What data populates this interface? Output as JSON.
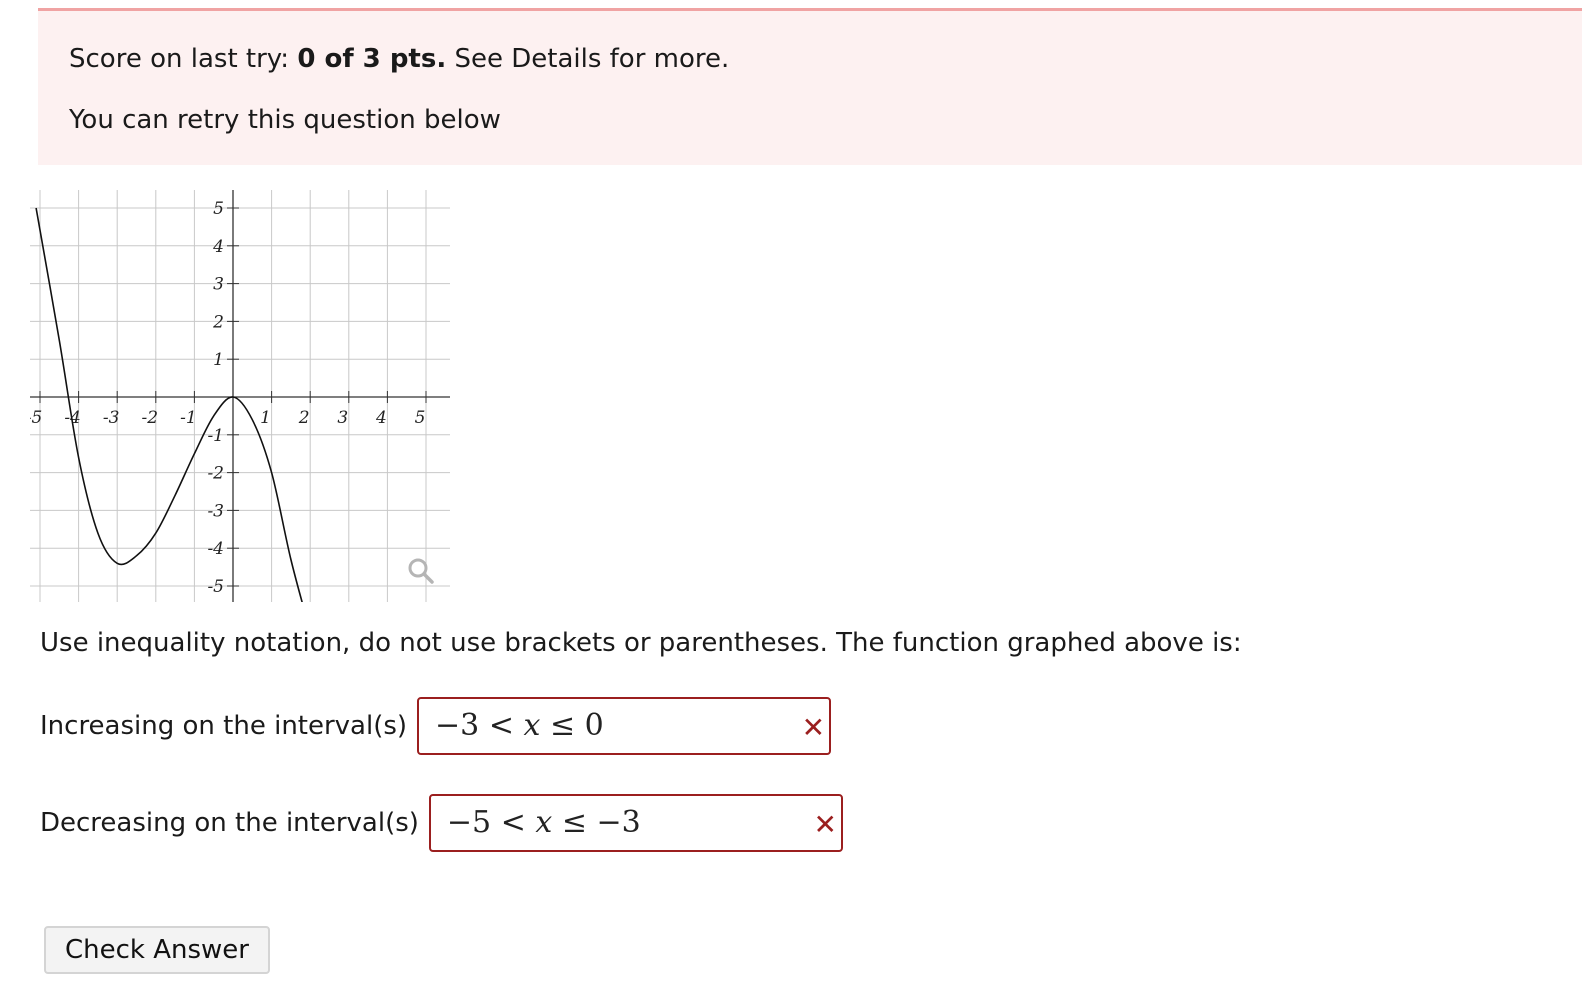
{
  "banner": {
    "score_prefix": "Score on last try: ",
    "score_value": "0 of 3 pts.",
    "score_suffix": " See Details for more.",
    "retry_text": "You can retry this question below"
  },
  "graph": {
    "x_ticks": [
      "-5",
      "-4",
      "-3",
      "-2",
      "-1",
      "1",
      "2",
      "3",
      "4",
      "5"
    ],
    "y_ticks": [
      "5",
      "4",
      "3",
      "2",
      "1",
      "-1",
      "-2",
      "-3",
      "-4",
      "-5"
    ],
    "zoom_icon": "magnifier-icon"
  },
  "chart_data": {
    "type": "line",
    "xlim": [
      -5,
      5
    ],
    "ylim": [
      -5,
      5
    ],
    "grid": true,
    "series": [
      {
        "x": [
          -5.1,
          -4.5,
          -4,
          -3.5,
          -3,
          -2.5,
          -2,
          -1.5,
          -1,
          -0.5,
          0,
          0.5,
          1,
          1.5,
          2
        ],
        "y": [
          5.0,
          1.5,
          -1.6,
          -3.6,
          -4.4,
          -4.2,
          -3.6,
          -2.6,
          -1.5,
          -0.5,
          0.0,
          -0.6,
          -2.0,
          -4.3,
          -6.2
        ]
      }
    ]
  },
  "instructions": "Use inequality notation, do not use brackets or parentheses. The function graphed above is:",
  "increasing": {
    "label": "Increasing on the interval(s)",
    "a": "−3",
    "op1": " < ",
    "var": "x",
    "op2": " ≤ ",
    "b": "0",
    "status_icon": "✕"
  },
  "decreasing": {
    "label": "Decreasing on the interval(s)",
    "a": "−5",
    "op1": " < ",
    "var": "x",
    "op2": " ≤ ",
    "b": "−3",
    "status_icon": "✕"
  },
  "check_button": "Check Answer",
  "colors": {
    "banner_bg": "#fdf1f1",
    "banner_border": "#f0a3a3",
    "error": "#9b1f1f"
  }
}
